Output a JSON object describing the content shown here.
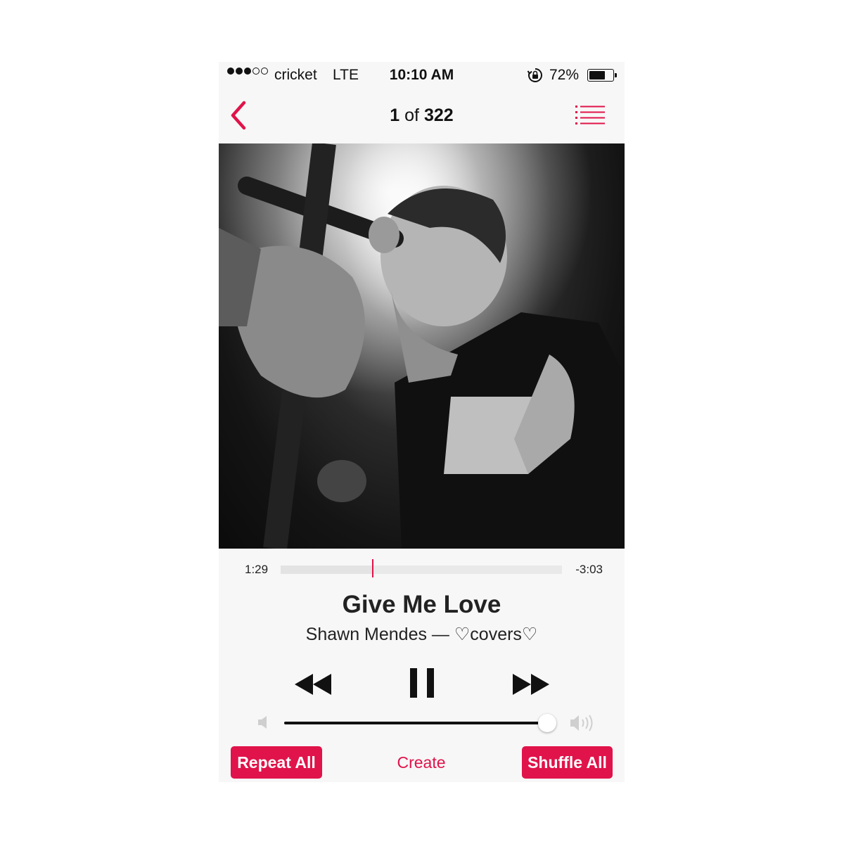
{
  "status_bar": {
    "signal_dots": [
      true,
      true,
      true,
      false,
      false
    ],
    "carrier": "cricket",
    "network": "LTE",
    "time": "10:10 AM",
    "rotation_lock_icon": "rotation-lock-icon",
    "battery_percent": "72%",
    "battery_level": 0.72
  },
  "nav": {
    "back_icon": "chevron-left-icon",
    "title_current": "1",
    "title_of": "of",
    "title_total": "322",
    "list_icon": "list-icon"
  },
  "artwork": {
    "description_icon": "album-artwork-image"
  },
  "progress": {
    "elapsed": "1:29",
    "remaining": "-3:03",
    "fraction": 0.325
  },
  "track": {
    "title": "Give Me Love",
    "subtitle": "Shawn Mendes — ♡covers♡"
  },
  "controls": {
    "rewind_icon": "rewind-icon",
    "pause_icon": "pause-icon",
    "forward_icon": "fast-forward-icon"
  },
  "volume": {
    "level": 0.98,
    "low_icon": "speaker-low-icon",
    "high_icon": "speaker-high-icon"
  },
  "buttons": {
    "repeat": "Repeat All",
    "create": "Create",
    "shuffle": "Shuffle All"
  },
  "colors": {
    "accent": "#e0134a",
    "background": "#f7f7f7"
  }
}
